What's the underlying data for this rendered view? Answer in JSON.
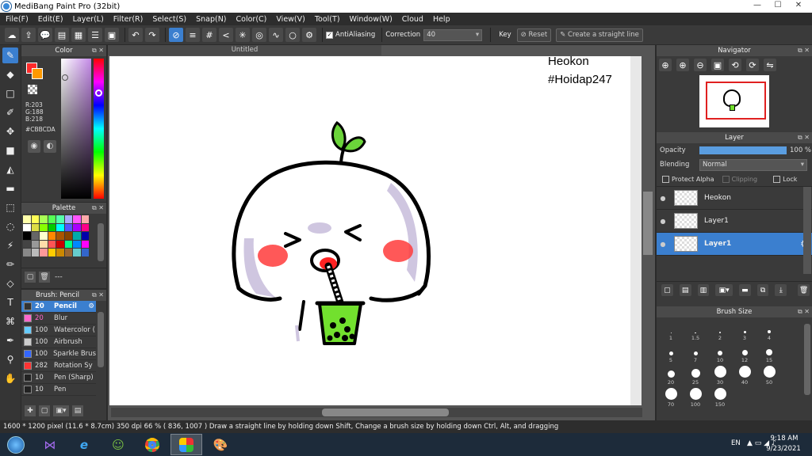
{
  "window": {
    "title": "MediBang Paint Pro (32bit)",
    "buttons": [
      "—",
      "☐",
      "✕"
    ]
  },
  "menu": [
    "File(F)",
    "Edit(E)",
    "Layer(L)",
    "Filter(R)",
    "Select(S)",
    "Snap(N)",
    "Color(C)",
    "View(V)",
    "Tool(T)",
    "Window(W)",
    "Cloud",
    "Help"
  ],
  "toolbar": {
    "antialias_label": "AntiAliasing",
    "correction_label": "Correction",
    "correction_value": "40",
    "key_label": "Key",
    "reset_label": "Reset",
    "straight_line_label": "Create a straight line"
  },
  "color_panel": {
    "title": "Color",
    "r": "R:203",
    "g": "G:188",
    "b": "B:218",
    "hex": "#CBBCDA",
    "primary": "#ff2a2a",
    "secondary": "#ffffff"
  },
  "palette": {
    "title": "Palette",
    "footer": "---",
    "swatches": [
      "#ffffaa",
      "#ffff55",
      "#aaff55",
      "#55ff55",
      "#55ffaa",
      "#aaaaff",
      "#ff55ff",
      "#ffaaaa",
      "#ffffff",
      "#dddd44",
      "#88ff00",
      "#00cc00",
      "#00ffff",
      "#5555ff",
      "#aa00ff",
      "#ff0088",
      "#000000",
      "#666666",
      "#ffffcc",
      "#ff8800",
      "#aa5500",
      "#884400",
      "#00aaaa",
      "#0000aa",
      "#444444",
      "#999999",
      "#ffddaa",
      "#ff5555",
      "#cc0000",
      "#00ff88",
      "#0088ff",
      "#ff00ff",
      "#888888",
      "#bbbbbb",
      "#ff9999",
      "#ffcc00",
      "#cc8800",
      "#996633",
      "#66cccc",
      "#3366cc"
    ]
  },
  "brush_panel": {
    "title": "Brush: Pencil",
    "items": [
      {
        "size": "20",
        "name": "Pencil",
        "color": "#333333"
      },
      {
        "size": "20",
        "name": "Blur",
        "color": "#ff66cc"
      },
      {
        "size": "100",
        "name": "Watercolor (",
        "color": "#66ccff"
      },
      {
        "size": "100",
        "name": "Airbrush",
        "color": "#cccccc"
      },
      {
        "size": "100",
        "name": "Sparkle Brus",
        "color": "#3366ff"
      },
      {
        "size": "282",
        "name": "Rotation Sy",
        "color": "#ff3333"
      },
      {
        "size": "10",
        "name": "Pen (Sharp)",
        "color": "#222222"
      },
      {
        "size": "10",
        "name": "Pen",
        "color": "#222222"
      }
    ]
  },
  "canvas": {
    "tab": "Untitled",
    "text_line1": "Heokon",
    "text_line2": "#Hoidap247"
  },
  "navigator": {
    "title": "Navigator"
  },
  "layer_panel": {
    "title": "Layer",
    "opacity_label": "Opacity",
    "opacity_value": "100 %",
    "opacity_level": 1.0,
    "blending_label": "Blending",
    "blending_value": "Normal",
    "protect_alpha": "Protect Alpha",
    "clipping": "Clipping",
    "lock": "Lock",
    "layers": [
      {
        "name": "Heokon",
        "selected": false
      },
      {
        "name": "Layer1",
        "selected": false
      },
      {
        "name": "Layer1",
        "selected": true
      }
    ]
  },
  "brush_size_panel": {
    "title": "Brush Size",
    "sizes": [
      "1",
      "1.5",
      "2",
      "3",
      "4",
      "5",
      "7",
      "10",
      "12",
      "15",
      "20",
      "25",
      "30",
      "40",
      "50",
      "70",
      "100",
      "150"
    ]
  },
  "status": {
    "text": "1600 * 1200 pixel   (11.6 * 8.7cm)   350 dpi   66 %   ( 836, 1007 )   Draw a straight line by holding down Shift, Change a brush size by holding down Ctrl, Alt, and dragging"
  },
  "taskbar": {
    "lang": "EN",
    "time": "9:18 AM",
    "date": "9/23/2021"
  }
}
